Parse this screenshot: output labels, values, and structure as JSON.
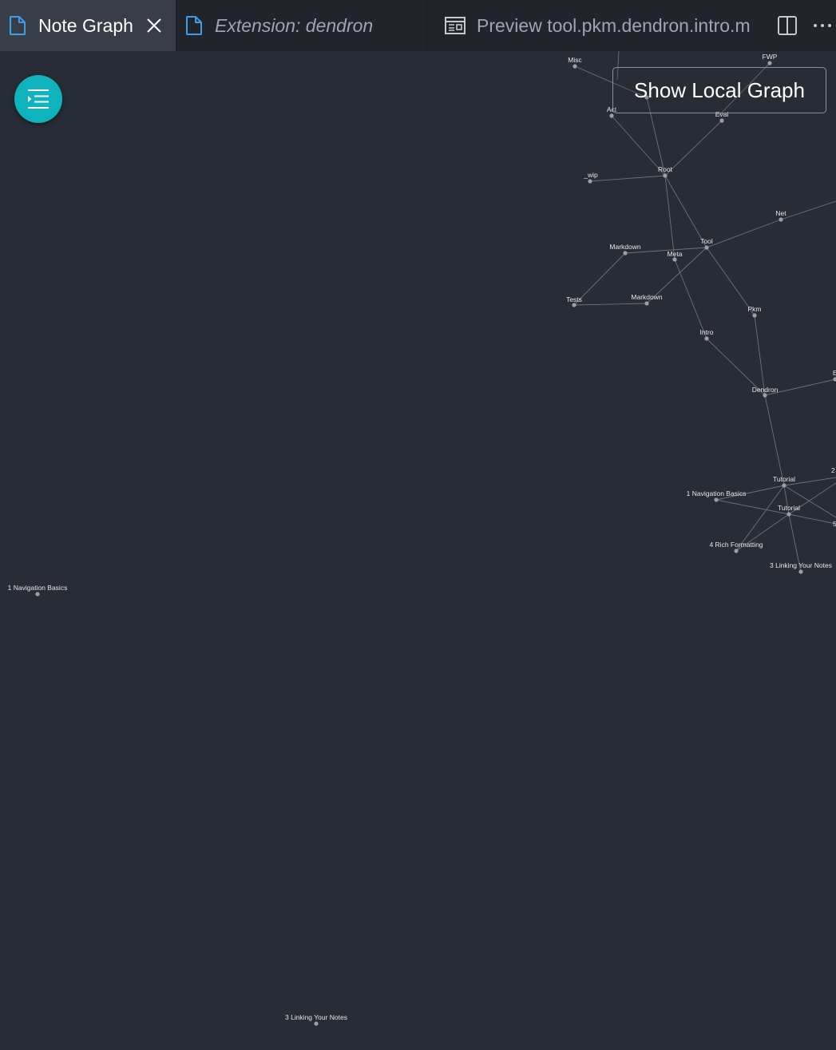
{
  "tabs": [
    {
      "label": "Note Graph",
      "icon": "file-icon",
      "active": true,
      "closable": true
    },
    {
      "label": "Extension: dendron",
      "icon": "file-icon",
      "active": false,
      "italic": true
    },
    {
      "label": "Preview tool.pkm.dendron.intro.m",
      "icon": "preview-icon",
      "active": false
    }
  ],
  "actions": {
    "split_icon": "split-editor-icon",
    "more_icon": "more-actions-icon"
  },
  "graph": {
    "local_button_label": "Show Local Graph",
    "menu_icon": "menu-indent-icon",
    "colors": {
      "background": "#282c34",
      "node": "#9a9ea6",
      "edge": "#6d717a",
      "label": "#e6e6e6",
      "accent": "#0fb3bd"
    },
    "node_labels": [
      "Misc",
      "FWP",
      "Act",
      "Eval",
      "Root",
      "_wip",
      "Net",
      "Tool",
      "Markdown",
      "Meta",
      "Tests",
      "Markdown",
      "Pkm",
      "Intro",
      "Dendron",
      "Tutorial",
      "1 Navigation Basics",
      "Tutorial",
      "4 Rich Formatting",
      "3 Linking Your Notes",
      "1 Navigation Basics",
      "3 Linking Your Notes",
      "E",
      "2",
      "5"
    ]
  }
}
